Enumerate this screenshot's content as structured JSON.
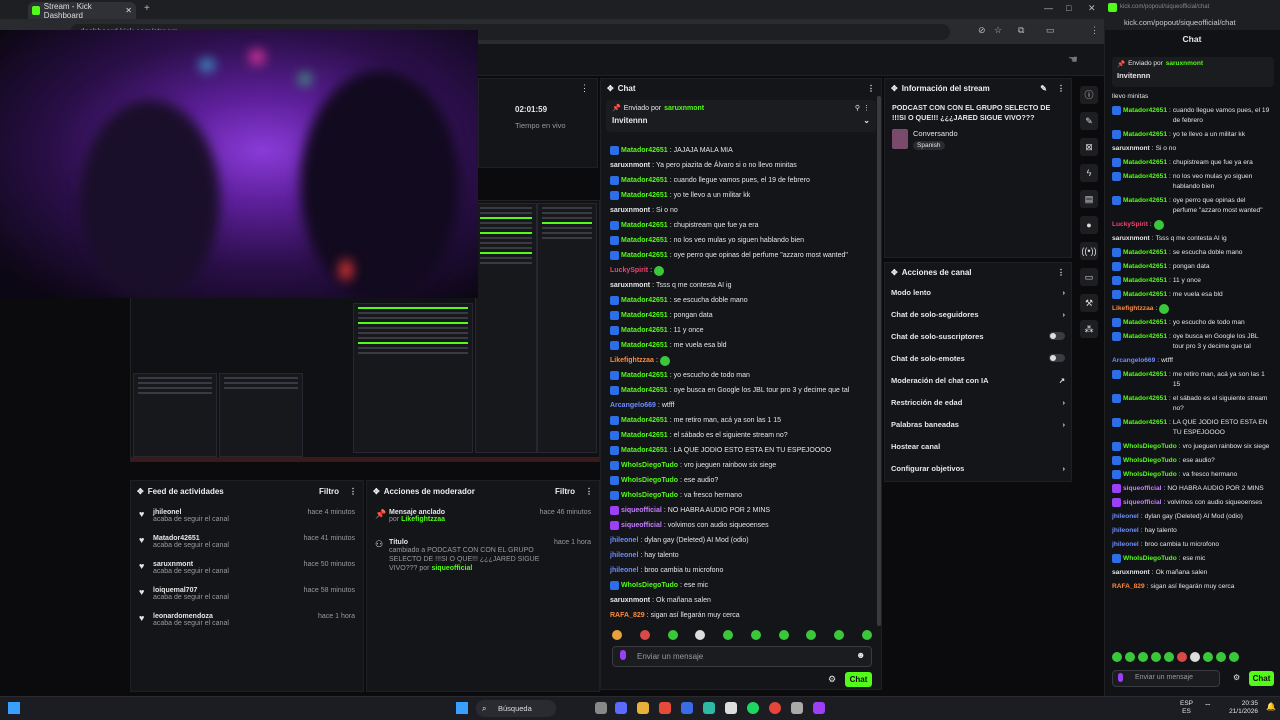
{
  "browser": {
    "tab_title": "Stream - Kick Dashboard",
    "url": "dashboard.kick.com/stream"
  },
  "popout_browser": {
    "url": "kick.com/popout/siqueofficial/chat",
    "header": "Chat"
  },
  "stream": {
    "uptime": "02:01:59",
    "uptime_label": "Tiempo en vivo"
  },
  "chat": {
    "title": "Chat",
    "pinned_label": "Enviado por",
    "pinned_user": "saruxnmont",
    "pinned_text": "Invitennn",
    "input_placeholder": "Enviar un mensaje",
    "send_label": "Chat",
    "messages": [
      {
        "user": "Matador42651",
        "color": "#53fc18",
        "badge": "blue",
        "text": "JAJAJA MALA MIA"
      },
      {
        "user": "saruxnmont",
        "color": "#e6e6e6",
        "badge": "",
        "text": "Ya pero piazita de Álvaro si o no llevo minitas"
      },
      {
        "user": "Matador42651",
        "color": "#53fc18",
        "badge": "blue",
        "text": "cuando llegue vamos pues, el 19 de febrero"
      },
      {
        "user": "Matador42651",
        "color": "#53fc18",
        "badge": "blue",
        "text": "yo te llevo a un militar kk"
      },
      {
        "user": "saruxnmont",
        "color": "#e6e6e6",
        "badge": "",
        "text": "Si o no"
      },
      {
        "user": "Matador42651",
        "color": "#53fc18",
        "badge": "blue",
        "text": "chupistream que fue ya era"
      },
      {
        "user": "Matador42651",
        "color": "#53fc18",
        "badge": "blue",
        "text": "no los veo mulas yo siguen hablando bien"
      },
      {
        "user": "Matador42651",
        "color": "#53fc18",
        "badge": "blue",
        "text": "oye perro que opinas del perfume \"azzaro most wanted\""
      },
      {
        "user": "LuckySpirit",
        "color": "#f0426f",
        "badge": "",
        "text": ""
      },
      {
        "user": "saruxnmont",
        "color": "#e6e6e6",
        "badge": "",
        "text": "Tsss q me contesta AI ig"
      },
      {
        "user": "Matador42651",
        "color": "#53fc18",
        "badge": "blue",
        "text": "se escucha doble mano"
      },
      {
        "user": "Matador42651",
        "color": "#53fc18",
        "badge": "blue",
        "text": "pongan data"
      },
      {
        "user": "Matador42651",
        "color": "#53fc18",
        "badge": "blue",
        "text": "11 y once"
      },
      {
        "user": "Matador42651",
        "color": "#53fc18",
        "badge": "blue",
        "text": "me vuela esa bld"
      },
      {
        "user": "Likefightzzaa",
        "color": "#ff8a3d",
        "badge": "",
        "text": ""
      },
      {
        "user": "Matador42651",
        "color": "#53fc18",
        "badge": "blue",
        "text": "yo escucho de todo man"
      },
      {
        "user": "Matador42651",
        "color": "#53fc18",
        "badge": "blue",
        "text": "oye busca en Google los JBL tour pro 3 y decime que tal"
      },
      {
        "user": "Arcangelo669",
        "color": "#6d8cff",
        "badge": "",
        "text": "wtfff"
      },
      {
        "user": "Matador42651",
        "color": "#53fc18",
        "badge": "blue",
        "text": "me retiro man, acá ya son las 1 15"
      },
      {
        "user": "Matador42651",
        "color": "#53fc18",
        "badge": "blue",
        "text": "el sábado es el siguiente stream no?"
      },
      {
        "user": "Matador42651",
        "color": "#53fc18",
        "badge": "blue",
        "text": "LA QUE JODIO ESTO ESTA EN TU ESPEJOOOO"
      },
      {
        "user": "WhoIsDiegoTudo",
        "color": "#53fc18",
        "badge": "blue",
        "text": "vro jueguen rainbow six siege"
      },
      {
        "user": "WhoIsDiegoTudo",
        "color": "#53fc18",
        "badge": "blue",
        "text": "ese audio?"
      },
      {
        "user": "WhoIsDiegoTudo",
        "color": "#53fc18",
        "badge": "blue",
        "text": "va fresco hermano"
      },
      {
        "user": "siqueofficial",
        "color": "#c77dff",
        "badge": "purple",
        "text": "NO HABRA AUDIO POR 2 MINS"
      },
      {
        "user": "siqueofficial",
        "color": "#c77dff",
        "badge": "purple",
        "text": "volvimos con audio siqueoenses"
      },
      {
        "user": "jhileonel",
        "color": "#6d8cff",
        "badge": "",
        "text": "dylan gay (Deleted) AI Mod (odio)"
      },
      {
        "user": "jhileonel",
        "color": "#6d8cff",
        "badge": "",
        "text": "hay talento"
      },
      {
        "user": "jhileonel",
        "color": "#6d8cff",
        "badge": "",
        "text": "broo cambia tu microfono"
      },
      {
        "user": "WhoIsDiegoTudo",
        "color": "#53fc18",
        "badge": "blue",
        "text": "ese mic"
      },
      {
        "user": "saruxnmont",
        "color": "#e6e6e6",
        "badge": "",
        "text": "Ok mañana salen"
      },
      {
        "user": "RAFA_829",
        "color": "#ff8a3d",
        "badge": "",
        "text": "sigan así llegarán muy cerca"
      }
    ]
  },
  "stream_info": {
    "title": "Información del stream",
    "stream_title": "PODCAST CON CON EL GRUPO SELECTO DE !!!SI O QUE!!! ¿¿¿JARED SIGUE VIVO???",
    "category": "Conversando",
    "language": "Spanish"
  },
  "channel_actions": {
    "title": "Acciones de canal",
    "items": [
      {
        "label": "Modo lento",
        "control": "chevron"
      },
      {
        "label": "Chat de solo-seguidores",
        "control": "chevron"
      },
      {
        "label": "Chat de solo-suscriptores",
        "control": "toggle"
      },
      {
        "label": "Chat de solo-emotes",
        "control": "toggle"
      },
      {
        "label": "Moderación del chat con IA",
        "control": "external"
      },
      {
        "label": "Restricción de edad",
        "control": "chevron"
      },
      {
        "label": "Palabras baneadas",
        "control": "chevron"
      },
      {
        "label": "Hostear canal",
        "control": ""
      },
      {
        "label": "Configurar objetivos",
        "control": "chevron"
      }
    ]
  },
  "activity_feed": {
    "title": "Feed de actividades",
    "filter_label": "Filtro",
    "items": [
      {
        "user": "jhileonel",
        "action": "acaba de seguir el canal",
        "time": "hace 4 minutos"
      },
      {
        "user": "Matador42651",
        "action": "acaba de seguir el canal",
        "time": "hace 41 minutos"
      },
      {
        "user": "saruxnmont",
        "action": "acaba de seguir el canal",
        "time": "hace 50 minutos"
      },
      {
        "user": "loiquemal707",
        "action": "acaba de seguir el canal",
        "time": "hace 58 minutos"
      },
      {
        "user": "leonardomendoza",
        "action": "acaba de seguir el canal",
        "time": "hace 1 hora"
      }
    ]
  },
  "mod_actions": {
    "title": "Acciones de moderador",
    "filter_label": "Filtro",
    "items": [
      {
        "title": "Mensaje anclado",
        "by_label": "por",
        "by": "Likefightzzaa",
        "time": "hace 46 minutos"
      },
      {
        "title": "Título",
        "detail": "cambiado a PODCAST CON CON EL GRUPO SELECTO DE !!!SI O QUE!!! ¿¿¿JARED SIGUE VIVO???",
        "by_label": "por",
        "by": "siqueofficial",
        "time": "hace 1 hora"
      }
    ]
  },
  "popout_chat": {
    "pinned_label": "Enviado por",
    "pinned_user": "saruxnmont",
    "pinned_text": "Invitennn",
    "input_placeholder": "Enviar un mensaje",
    "send_label": "Chat",
    "messages": [
      {
        "user": "",
        "color": "#e6e6e6",
        "badge": "",
        "text": "llevo minitas"
      },
      {
        "user": "Matador42651",
        "color": "#53fc18",
        "badge": "blue",
        "text": "cuando llegue vamos pues, el 19 de febrero"
      },
      {
        "user": "Matador42651",
        "color": "#53fc18",
        "badge": "blue",
        "text": "yo te llevo a un militar kk"
      },
      {
        "user": "saruxnmont",
        "color": "#e6e6e6",
        "badge": "",
        "text": "Si o no"
      },
      {
        "user": "Matador42651",
        "color": "#53fc18",
        "badge": "blue",
        "text": "chupistream que fue ya era"
      },
      {
        "user": "Matador42651",
        "color": "#53fc18",
        "badge": "blue",
        "text": "no los veo mulas yo siguen hablando bien"
      },
      {
        "user": "Matador42651",
        "color": "#53fc18",
        "badge": "blue",
        "text": "oye perro que opinas del perfume \"azzaro most wanted\""
      },
      {
        "user": "LuckySpirit",
        "color": "#f0426f",
        "badge": "",
        "text": ""
      },
      {
        "user": "saruxnmont",
        "color": "#e6e6e6",
        "badge": "",
        "text": "Tsss q me contesta AI ig"
      },
      {
        "user": "Matador42651",
        "color": "#53fc18",
        "badge": "blue",
        "text": "se escucha doble mano"
      },
      {
        "user": "Matador42651",
        "color": "#53fc18",
        "badge": "blue",
        "text": "pongan data"
      },
      {
        "user": "Matador42651",
        "color": "#53fc18",
        "badge": "blue",
        "text": "11 y once"
      },
      {
        "user": "Matador42651",
        "color": "#53fc18",
        "badge": "blue",
        "text": "me vuela esa bld"
      },
      {
        "user": "Likefightzzaa",
        "color": "#ff8a3d",
        "badge": "",
        "text": ""
      },
      {
        "user": "Matador42651",
        "color": "#53fc18",
        "badge": "blue",
        "text": "yo escucho de todo man"
      },
      {
        "user": "Matador42651",
        "color": "#53fc18",
        "badge": "blue",
        "text": "oye busca en Google los JBL tour pro 3 y decime que tal"
      },
      {
        "user": "Arcangelo669",
        "color": "#6d8cff",
        "badge": "",
        "text": "wtfff"
      },
      {
        "user": "Matador42651",
        "color": "#53fc18",
        "badge": "blue",
        "text": "me retiro man, acá ya son las 1 15"
      },
      {
        "user": "Matador42651",
        "color": "#53fc18",
        "badge": "blue",
        "text": "el sábado es el siguiente stream no?"
      },
      {
        "user": "Matador42651",
        "color": "#53fc18",
        "badge": "blue",
        "text": "LA QUE JODIO ESTO ESTA EN TU ESPEJOOOO"
      },
      {
        "user": "WhoIsDiegoTudo",
        "color": "#53fc18",
        "badge": "blue",
        "text": "vro jueguen rainbow six siege"
      },
      {
        "user": "WhoIsDiegoTudo",
        "color": "#53fc18",
        "badge": "blue",
        "text": "ese audio?"
      },
      {
        "user": "WhoIsDiegoTudo",
        "color": "#53fc18",
        "badge": "blue",
        "text": "va fresco hermano"
      },
      {
        "user": "siqueofficial",
        "color": "#c77dff",
        "badge": "purple",
        "text": "NO HABRA AUDIO POR 2 MINS"
      },
      {
        "user": "siqueofficial",
        "color": "#c77dff",
        "badge": "purple",
        "text": "volvimos con audio siqueoenses"
      },
      {
        "user": "jhileonel",
        "color": "#6d8cff",
        "badge": "",
        "text": "dylan gay (Deleted) AI Mod (odio)"
      },
      {
        "user": "jhileonel",
        "color": "#6d8cff",
        "badge": "",
        "text": "hay talento"
      },
      {
        "user": "jhileonel",
        "color": "#6d8cff",
        "badge": "",
        "text": "broo cambia tu microfono"
      },
      {
        "user": "WhoIsDiegoTudo",
        "color": "#53fc18",
        "badge": "blue",
        "text": "ese mic"
      },
      {
        "user": "saruxnmont",
        "color": "#e6e6e6",
        "badge": "",
        "text": "Ok mañana salen"
      },
      {
        "user": "RAFA_829",
        "color": "#ff8a3d",
        "badge": "",
        "text": "sigan así llegarán muy cerca"
      }
    ]
  },
  "taskbar": {
    "search_label": "Búsqueda",
    "lang": "ESP",
    "lang2": "ES",
    "time": "20:35",
    "date": "21/1/2026"
  },
  "colors": {
    "accent": "#53fc18",
    "panel": "#141519",
    "bg": "#0b0b0e"
  }
}
